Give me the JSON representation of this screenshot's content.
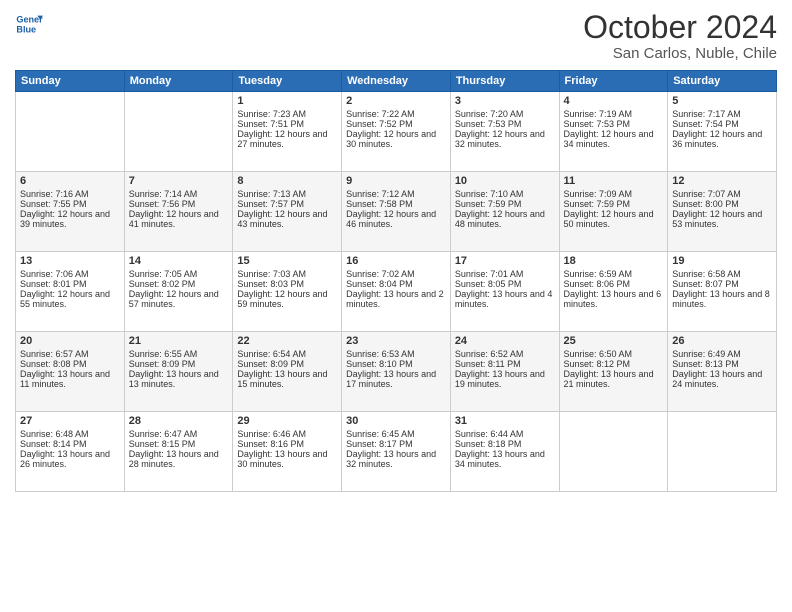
{
  "logo": {
    "line1": "General",
    "line2": "Blue"
  },
  "title": "October 2024",
  "location": "San Carlos, Nuble, Chile",
  "headers": [
    "Sunday",
    "Monday",
    "Tuesday",
    "Wednesday",
    "Thursday",
    "Friday",
    "Saturday"
  ],
  "weeks": [
    [
      {
        "day": "",
        "sunrise": "",
        "sunset": "",
        "daylight": ""
      },
      {
        "day": "",
        "sunrise": "",
        "sunset": "",
        "daylight": ""
      },
      {
        "day": "1",
        "sunrise": "Sunrise: 7:23 AM",
        "sunset": "Sunset: 7:51 PM",
        "daylight": "Daylight: 12 hours and 27 minutes."
      },
      {
        "day": "2",
        "sunrise": "Sunrise: 7:22 AM",
        "sunset": "Sunset: 7:52 PM",
        "daylight": "Daylight: 12 hours and 30 minutes."
      },
      {
        "day": "3",
        "sunrise": "Sunrise: 7:20 AM",
        "sunset": "Sunset: 7:53 PM",
        "daylight": "Daylight: 12 hours and 32 minutes."
      },
      {
        "day": "4",
        "sunrise": "Sunrise: 7:19 AM",
        "sunset": "Sunset: 7:53 PM",
        "daylight": "Daylight: 12 hours and 34 minutes."
      },
      {
        "day": "5",
        "sunrise": "Sunrise: 7:17 AM",
        "sunset": "Sunset: 7:54 PM",
        "daylight": "Daylight: 12 hours and 36 minutes."
      }
    ],
    [
      {
        "day": "6",
        "sunrise": "Sunrise: 7:16 AM",
        "sunset": "Sunset: 7:55 PM",
        "daylight": "Daylight: 12 hours and 39 minutes."
      },
      {
        "day": "7",
        "sunrise": "Sunrise: 7:14 AM",
        "sunset": "Sunset: 7:56 PM",
        "daylight": "Daylight: 12 hours and 41 minutes."
      },
      {
        "day": "8",
        "sunrise": "Sunrise: 7:13 AM",
        "sunset": "Sunset: 7:57 PM",
        "daylight": "Daylight: 12 hours and 43 minutes."
      },
      {
        "day": "9",
        "sunrise": "Sunrise: 7:12 AM",
        "sunset": "Sunset: 7:58 PM",
        "daylight": "Daylight: 12 hours and 46 minutes."
      },
      {
        "day": "10",
        "sunrise": "Sunrise: 7:10 AM",
        "sunset": "Sunset: 7:59 PM",
        "daylight": "Daylight: 12 hours and 48 minutes."
      },
      {
        "day": "11",
        "sunrise": "Sunrise: 7:09 AM",
        "sunset": "Sunset: 7:59 PM",
        "daylight": "Daylight: 12 hours and 50 minutes."
      },
      {
        "day": "12",
        "sunrise": "Sunrise: 7:07 AM",
        "sunset": "Sunset: 8:00 PM",
        "daylight": "Daylight: 12 hours and 53 minutes."
      }
    ],
    [
      {
        "day": "13",
        "sunrise": "Sunrise: 7:06 AM",
        "sunset": "Sunset: 8:01 PM",
        "daylight": "Daylight: 12 hours and 55 minutes."
      },
      {
        "day": "14",
        "sunrise": "Sunrise: 7:05 AM",
        "sunset": "Sunset: 8:02 PM",
        "daylight": "Daylight: 12 hours and 57 minutes."
      },
      {
        "day": "15",
        "sunrise": "Sunrise: 7:03 AM",
        "sunset": "Sunset: 8:03 PM",
        "daylight": "Daylight: 12 hours and 59 minutes."
      },
      {
        "day": "16",
        "sunrise": "Sunrise: 7:02 AM",
        "sunset": "Sunset: 8:04 PM",
        "daylight": "Daylight: 13 hours and 2 minutes."
      },
      {
        "day": "17",
        "sunrise": "Sunrise: 7:01 AM",
        "sunset": "Sunset: 8:05 PM",
        "daylight": "Daylight: 13 hours and 4 minutes."
      },
      {
        "day": "18",
        "sunrise": "Sunrise: 6:59 AM",
        "sunset": "Sunset: 8:06 PM",
        "daylight": "Daylight: 13 hours and 6 minutes."
      },
      {
        "day": "19",
        "sunrise": "Sunrise: 6:58 AM",
        "sunset": "Sunset: 8:07 PM",
        "daylight": "Daylight: 13 hours and 8 minutes."
      }
    ],
    [
      {
        "day": "20",
        "sunrise": "Sunrise: 6:57 AM",
        "sunset": "Sunset: 8:08 PM",
        "daylight": "Daylight: 13 hours and 11 minutes."
      },
      {
        "day": "21",
        "sunrise": "Sunrise: 6:55 AM",
        "sunset": "Sunset: 8:09 PM",
        "daylight": "Daylight: 13 hours and 13 minutes."
      },
      {
        "day": "22",
        "sunrise": "Sunrise: 6:54 AM",
        "sunset": "Sunset: 8:09 PM",
        "daylight": "Daylight: 13 hours and 15 minutes."
      },
      {
        "day": "23",
        "sunrise": "Sunrise: 6:53 AM",
        "sunset": "Sunset: 8:10 PM",
        "daylight": "Daylight: 13 hours and 17 minutes."
      },
      {
        "day": "24",
        "sunrise": "Sunrise: 6:52 AM",
        "sunset": "Sunset: 8:11 PM",
        "daylight": "Daylight: 13 hours and 19 minutes."
      },
      {
        "day": "25",
        "sunrise": "Sunrise: 6:50 AM",
        "sunset": "Sunset: 8:12 PM",
        "daylight": "Daylight: 13 hours and 21 minutes."
      },
      {
        "day": "26",
        "sunrise": "Sunrise: 6:49 AM",
        "sunset": "Sunset: 8:13 PM",
        "daylight": "Daylight: 13 hours and 24 minutes."
      }
    ],
    [
      {
        "day": "27",
        "sunrise": "Sunrise: 6:48 AM",
        "sunset": "Sunset: 8:14 PM",
        "daylight": "Daylight: 13 hours and 26 minutes."
      },
      {
        "day": "28",
        "sunrise": "Sunrise: 6:47 AM",
        "sunset": "Sunset: 8:15 PM",
        "daylight": "Daylight: 13 hours and 28 minutes."
      },
      {
        "day": "29",
        "sunrise": "Sunrise: 6:46 AM",
        "sunset": "Sunset: 8:16 PM",
        "daylight": "Daylight: 13 hours and 30 minutes."
      },
      {
        "day": "30",
        "sunrise": "Sunrise: 6:45 AM",
        "sunset": "Sunset: 8:17 PM",
        "daylight": "Daylight: 13 hours and 32 minutes."
      },
      {
        "day": "31",
        "sunrise": "Sunrise: 6:44 AM",
        "sunset": "Sunset: 8:18 PM",
        "daylight": "Daylight: 13 hours and 34 minutes."
      },
      {
        "day": "",
        "sunrise": "",
        "sunset": "",
        "daylight": ""
      },
      {
        "day": "",
        "sunrise": "",
        "sunset": "",
        "daylight": ""
      }
    ]
  ]
}
